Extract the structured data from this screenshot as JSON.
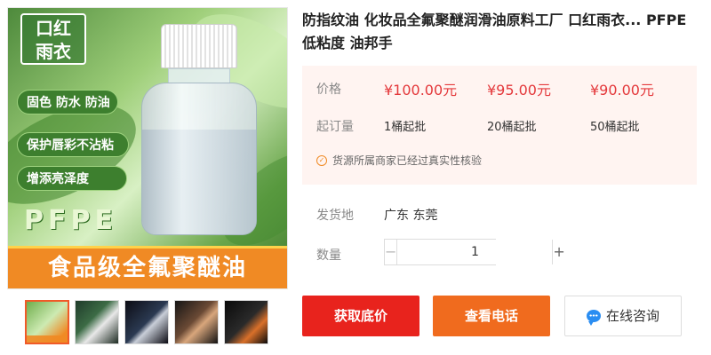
{
  "gallery": {
    "main_image": {
      "badge": "口红\n雨衣",
      "features": [
        "固色 防水 防油",
        "保护唇彩不沾粘",
        "增添亮泽度"
      ],
      "product_tag": "PFPE",
      "banner": "食品级全氟聚醚油"
    },
    "thumbnails": [
      {
        "icon": "thumb-bottle-green"
      },
      {
        "icon": "thumb-product-dark-green"
      },
      {
        "icon": "thumb-phone-blue"
      },
      {
        "icon": "thumb-makeup-brown"
      },
      {
        "icon": "thumb-flame-dark"
      }
    ]
  },
  "product": {
    "title": "防指纹油 化妆品全氟聚醚润滑油原料工厂 口红雨衣... PFPE低粘度 油邦手"
  },
  "pricing": {
    "price_label": "价格",
    "moq_label": "起订量",
    "tiers": [
      {
        "price": "¥100.00元",
        "moq": "1桶起批"
      },
      {
        "price": "¥95.00元",
        "moq": "20桶起批"
      },
      {
        "price": "¥90.00元",
        "moq": "50桶起批"
      }
    ],
    "verification": "货源所属商家已经过真实性核验",
    "accent_color": "#e4393c"
  },
  "shipping": {
    "label": "发货地",
    "value": "广东 东莞"
  },
  "quantity": {
    "label": "数量",
    "value": "1",
    "minus": "−",
    "plus": "+"
  },
  "actions": {
    "get_price": "获取底价",
    "view_phone": "查看电话",
    "chat": "在线咨询",
    "colors": {
      "get_price": "#e8231d",
      "view_phone": "#f06b1e"
    }
  }
}
